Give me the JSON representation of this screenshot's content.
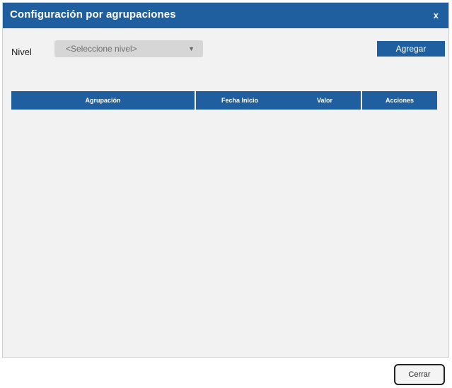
{
  "dialog": {
    "title": "Configuración por agrupaciones",
    "close_label": "x"
  },
  "filter": {
    "nivel_label": "Nivel",
    "nivel_select_value": "<Seleccione nivel>",
    "agregar_label": "Agregar"
  },
  "table": {
    "columns": [
      "Agrupación",
      "Fecha Inicio",
      "Valor",
      "Acciones"
    ],
    "rows": []
  },
  "footer": {
    "cerrar_label": "Cerrar"
  },
  "colors": {
    "accent": "#1f5fa0",
    "panel_bg": "#f2f2f2",
    "select_bg": "#d6d6d6"
  },
  "icons": {
    "select_arrow": "chevron-down-icon"
  }
}
